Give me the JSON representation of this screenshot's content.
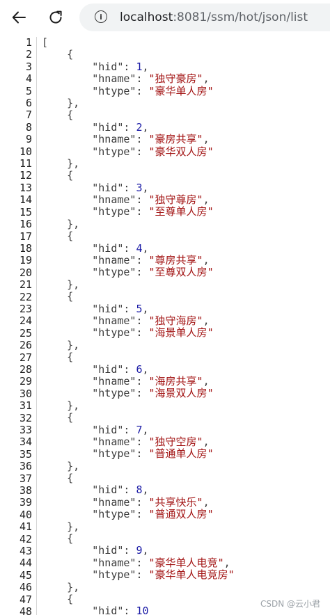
{
  "browser": {
    "url_host": "localhost",
    "url_path": ":8081/ssm/hot/json/list"
  },
  "json_viewer": {
    "line_numbers": [
      "1",
      "2",
      "3",
      "4",
      "5",
      "6",
      "7",
      "8",
      "9",
      "10",
      "11",
      "12",
      "13",
      "14",
      "15",
      "16",
      "17",
      "18",
      "19",
      "20",
      "21",
      "22",
      "23",
      "24",
      "25",
      "26",
      "27",
      "28",
      "29",
      "30",
      "31",
      "32",
      "33",
      "34",
      "35",
      "36",
      "37",
      "38",
      "39",
      "40",
      "41",
      "42",
      "43",
      "44",
      "45",
      "46",
      "47",
      "48"
    ],
    "records": [
      {
        "hid": "1",
        "hname": "独守豪房",
        "htype": "豪华单人房"
      },
      {
        "hid": "2",
        "hname": "豪房共享",
        "htype": "豪华双人房"
      },
      {
        "hid": "3",
        "hname": "独守尊房",
        "htype": "至尊单人房"
      },
      {
        "hid": "4",
        "hname": "尊房共享",
        "htype": "至尊双人房"
      },
      {
        "hid": "5",
        "hname": "独守海房",
        "htype": "海景单人房"
      },
      {
        "hid": "6",
        "hname": "海房共享",
        "htype": "海景双人房"
      },
      {
        "hid": "7",
        "hname": "独守空房",
        "htype": "普通单人房"
      },
      {
        "hid": "8",
        "hname": "共享快乐",
        "htype": "普通双人房"
      },
      {
        "hid": "9",
        "hname": "豪华单人电竞",
        "htype": "豪华单人电竞房"
      },
      {
        "hid": "10"
      }
    ]
  },
  "watermark": "CSDN @云小君",
  "colors": {
    "number": "#1a1aa6",
    "string": "#a31515"
  }
}
